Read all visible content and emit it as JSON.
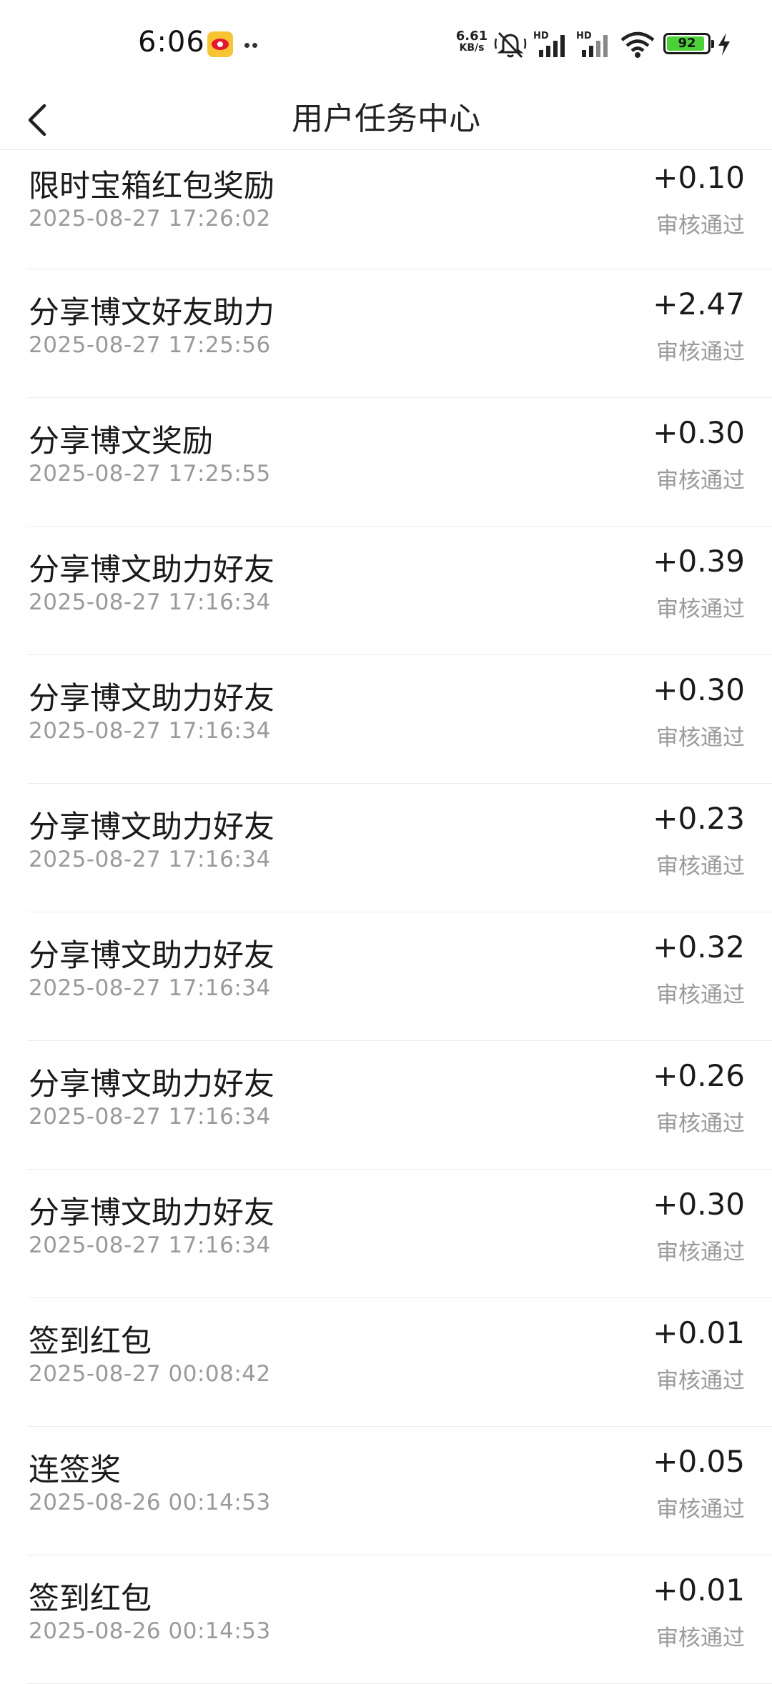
{
  "status_bar": {
    "time": "6:06",
    "net_speed_value": "6.61",
    "net_speed_unit": "KB/s",
    "battery_level": "92",
    "battery_color": "#4cd137",
    "icons": [
      "weibo-notification-icon",
      "more-dots-icon",
      "mute-icon",
      "signal-hd-icon",
      "signal-hd-icon",
      "wifi-icon",
      "battery-icon",
      "charging-bolt-icon"
    ]
  },
  "header": {
    "title": "用户任务中心",
    "back_icon": "chevron-left-icon"
  },
  "tasks": [
    {
      "name": "限时宝箱红包奖励",
      "time": "2025-08-27 17:26:02",
      "amount": "+0.10",
      "status": "审核通过"
    },
    {
      "name": "分享博文好友助力",
      "time": "2025-08-27 17:25:56",
      "amount": "+2.47",
      "status": "审核通过"
    },
    {
      "name": "分享博文奖励",
      "time": "2025-08-27 17:25:55",
      "amount": "+0.30",
      "status": "审核通过"
    },
    {
      "name": "分享博文助力好友",
      "time": "2025-08-27 17:16:34",
      "amount": "+0.39",
      "status": "审核通过"
    },
    {
      "name": "分享博文助力好友",
      "time": "2025-08-27 17:16:34",
      "amount": "+0.30",
      "status": "审核通过"
    },
    {
      "name": "分享博文助力好友",
      "time": "2025-08-27 17:16:34",
      "amount": "+0.23",
      "status": "审核通过"
    },
    {
      "name": "分享博文助力好友",
      "time": "2025-08-27 17:16:34",
      "amount": "+0.32",
      "status": "审核通过"
    },
    {
      "name": "分享博文助力好友",
      "time": "2025-08-27 17:16:34",
      "amount": "+0.26",
      "status": "审核通过"
    },
    {
      "name": "分享博文助力好友",
      "time": "2025-08-27 17:16:34",
      "amount": "+0.30",
      "status": "审核通过"
    },
    {
      "name": "签到红包",
      "time": "2025-08-27 00:08:42",
      "amount": "+0.01",
      "status": "审核通过"
    },
    {
      "name": "连签奖",
      "time": "2025-08-26 00:14:53",
      "amount": "+0.05",
      "status": "审核通过"
    },
    {
      "name": "签到红包",
      "time": "2025-08-26 00:14:53",
      "amount": "+0.01",
      "status": "审核通过"
    }
  ]
}
